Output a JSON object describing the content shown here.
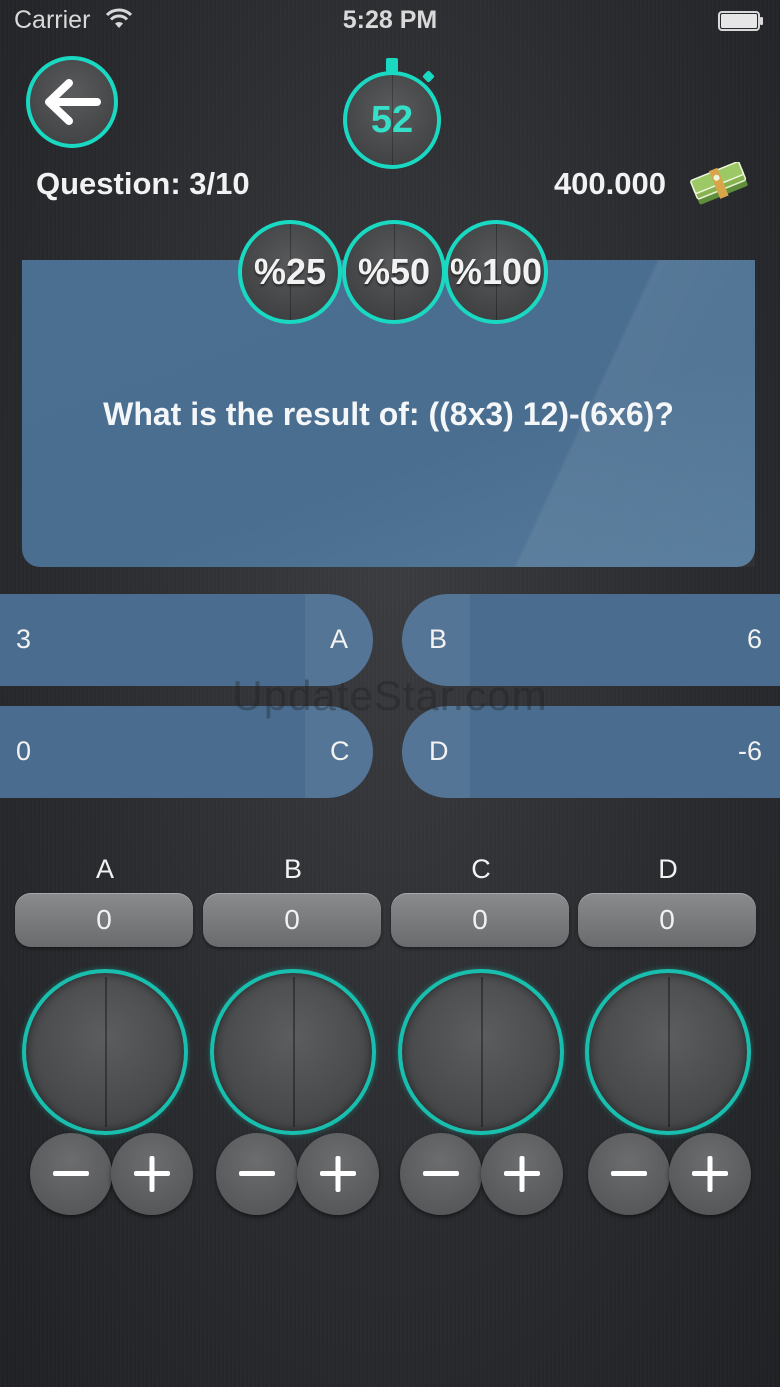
{
  "status_bar": {
    "carrier": "Carrier",
    "time": "5:28 PM"
  },
  "timer": {
    "seconds": "52"
  },
  "question": {
    "counter": "Question:  3/10",
    "text": "What is the result of: ((8x3) 12)-(6x6)?"
  },
  "score": "400.000",
  "lifelines": [
    {
      "label": "%25"
    },
    {
      "label": "%50"
    },
    {
      "label": "%100"
    }
  ],
  "answers": [
    {
      "letter": "A",
      "value": "3"
    },
    {
      "letter": "B",
      "value": "6"
    },
    {
      "letter": "C",
      "value": "0"
    },
    {
      "letter": "D",
      "value": "-6"
    }
  ],
  "watermark": "UpdateStar.com",
  "bets": [
    {
      "letter": "A",
      "amount": "0"
    },
    {
      "letter": "B",
      "amount": "0"
    },
    {
      "letter": "C",
      "amount": "0"
    },
    {
      "letter": "D",
      "amount": "0"
    }
  ],
  "icons": {
    "back": "arrow-left-icon",
    "money": "money-stack-icon",
    "minus": "minus-icon",
    "plus": "plus-icon"
  },
  "colors": {
    "accent": "#19d9c2",
    "panel": "#4a6d8f",
    "timer_text": "#36e0c8"
  }
}
